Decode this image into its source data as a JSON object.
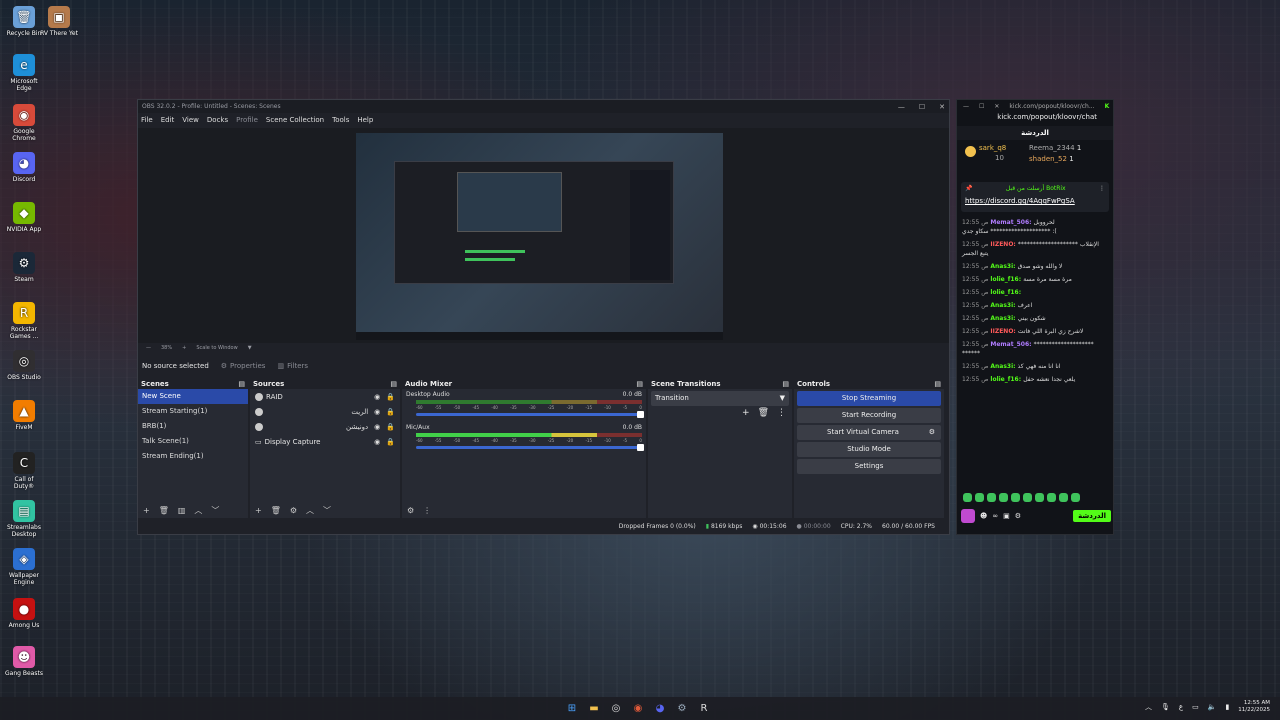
{
  "desktop": {
    "icons": [
      {
        "label": "Recycle Bin",
        "icon": "recycle-bin-icon",
        "color": "#6aa0d8",
        "glyph": "🗑"
      },
      {
        "label": "RV There Yet",
        "icon": "game-icon",
        "color": "#b57a4b",
        "glyph": "▣"
      },
      {
        "label": "Microsoft Edge",
        "icon": "edge-icon",
        "color": "#1e8fd8",
        "glyph": "e"
      },
      {
        "label": "Google Chrome",
        "icon": "chrome-icon",
        "color": "#d84a3a",
        "glyph": "◉"
      },
      {
        "label": "Discord",
        "icon": "discord-icon",
        "color": "#5865f2",
        "glyph": "◕"
      },
      {
        "label": "NVIDIA App",
        "icon": "nvidia-icon",
        "color": "#76b900",
        "glyph": "◆"
      },
      {
        "label": "Steam",
        "icon": "steam-icon",
        "color": "#1b2838",
        "glyph": "⚙"
      },
      {
        "label": "Rockstar Games ...",
        "icon": "rockstar-icon",
        "color": "#f3b600",
        "glyph": "R"
      },
      {
        "label": "OBS Studio",
        "icon": "obs-icon",
        "color": "#302e31",
        "glyph": "◎"
      },
      {
        "label": "FiveM",
        "icon": "fivem-icon",
        "color": "#f27d00",
        "glyph": "▲"
      },
      {
        "label": "Call of Duty®",
        "icon": "cod-icon",
        "color": "#222",
        "glyph": "C"
      },
      {
        "label": "Streamlabs Desktop",
        "icon": "streamlabs-icon",
        "color": "#31c3a2",
        "glyph": "▤"
      },
      {
        "label": "Wallpaper Engine",
        "icon": "wallpaper-engine-icon",
        "color": "#2b6fd1",
        "glyph": "◈"
      },
      {
        "label": "Among Us",
        "icon": "among-us-icon",
        "color": "#c51111",
        "glyph": "●"
      },
      {
        "label": "Gang Beasts",
        "icon": "gang-beasts-icon",
        "color": "#e05aa8",
        "glyph": "☻"
      }
    ]
  },
  "obs": {
    "title": "OBS 32.0.2 - Profile: Untitled - Scenes: Scenes",
    "menu": [
      "File",
      "Edit",
      "View",
      "Docks",
      "Profile",
      "Scene Collection",
      "Tools",
      "Help"
    ],
    "zoom": "38%",
    "zoom_mode": "Scale to Window",
    "no_source": "No source selected",
    "properties": "Properties",
    "filters": "Filters",
    "scenes_title": "Scenes",
    "scenes": [
      "New Scene",
      "Stream Starting(1)",
      "BRB(1)",
      "Talk Scene(1)",
      "Stream Ending(1)"
    ],
    "sources_title": "Sources",
    "sources": [
      "RAID",
      "الريت",
      "دونيشن",
      "Display Capture"
    ],
    "mixer_title": "Audio Mixer",
    "mixer": [
      {
        "name": "Desktop Audio",
        "db": "0.0 dB"
      },
      {
        "name": "Mic/Aux",
        "db": "0.0 dB"
      }
    ],
    "meter_scale": [
      "-60",
      "-55",
      "-50",
      "-45",
      "-40",
      "-35",
      "-30",
      "-25",
      "-20",
      "-15",
      "-10",
      "-5",
      "0"
    ],
    "transitions_title": "Scene Transitions",
    "transition_value": "Transition",
    "controls_title": "Controls",
    "controls": [
      "Stop Streaming",
      "Start Recording",
      "Start Virtual Camera",
      "Studio Mode",
      "Settings"
    ],
    "status": {
      "dropped": "Dropped Frames 0 (0.0%)",
      "bitrate": "8169 kbps",
      "stream_time": "00:15:06",
      "rec_time": "00:00:00",
      "cpu": "CPU: 2.7%",
      "fps": "60.00 / 60.00 FPS"
    }
  },
  "chat": {
    "url": "kick.com/popout/kloovr/chat",
    "titlebar_url": "kick.com/popout/kloovr/ch...",
    "header": "الدردشة",
    "leaders": [
      {
        "name": "sark_q8",
        "count": "10"
      },
      {
        "name": "Reema_2344",
        "count": "1"
      },
      {
        "name": "shaden_52",
        "count": "1"
      }
    ],
    "pinned_by": "أرسلت من قبل BotRix",
    "pinned_link": "https://discord.gg/4AqqFwPgSA",
    "messages": [
      {
        "time": "12:55 ص",
        "user": "Memat_506:",
        "color": "#b07cff",
        "text": "لحرووبل ******************** سكاو جدي :("
      },
      {
        "time": "12:55 ص",
        "user": "IIZENO:",
        "color": "#ff5a5a",
        "text": "******************** الإنقلاب يتبع الجسر"
      },
      {
        "time": "12:55 ص",
        "user": "Anas3i:",
        "color": "#53fc18",
        "text": "لا والله وشو صدق"
      },
      {
        "time": "12:55 ص",
        "user": "lolie_f16:",
        "color": "#53fc18",
        "text": "مرة مسة مرة مسة"
      },
      {
        "time": "12:55 ص",
        "user": "lolie_f16:",
        "color": "#53fc18",
        "text": ""
      },
      {
        "time": "12:55 ص",
        "user": "Anas3i:",
        "color": "#53fc18",
        "text": "اعرف"
      },
      {
        "time": "12:55 ص",
        "user": "Anas3i:",
        "color": "#53fc18",
        "text": "شكون بيني"
      },
      {
        "time": "12:55 ص",
        "user": "IIZENO:",
        "color": "#ff5a5a",
        "text": "لاشرح زي البرة اللي فاتت"
      },
      {
        "time": "12:55 ص",
        "user": "Memat_506:",
        "color": "#b07cff",
        "text": "******************** ******"
      },
      {
        "time": "12:55 ص",
        "user": "Anas3i:",
        "color": "#53fc18",
        "text": "انا انا منه فهي كذ"
      },
      {
        "time": "12:55 ص",
        "user": "lolie_f16:",
        "color": "#53fc18",
        "text": "يلعي نجدا نعشه حفل"
      }
    ],
    "send_label": "الدردشة"
  },
  "taskbar": {
    "apps": [
      {
        "name": "start-icon",
        "glyph": "⊞",
        "color": "#4aa3ff"
      },
      {
        "name": "file-explorer-icon",
        "glyph": "▬",
        "color": "#f2c14e"
      },
      {
        "name": "obs-taskbar-icon",
        "glyph": "◎",
        "color": "#ddd"
      },
      {
        "name": "chrome-taskbar-icon",
        "glyph": "◉",
        "color": "#e05a3a"
      },
      {
        "name": "discord-taskbar-icon",
        "glyph": "◕",
        "color": "#5865f2"
      },
      {
        "name": "steam-taskbar-icon",
        "glyph": "⚙",
        "color": "#9ab"
      },
      {
        "name": "rockstar-taskbar-icon",
        "glyph": "R",
        "color": "#ddd"
      }
    ],
    "lang": "ع",
    "time": "12:55 AM",
    "date": "11/22/2025"
  }
}
